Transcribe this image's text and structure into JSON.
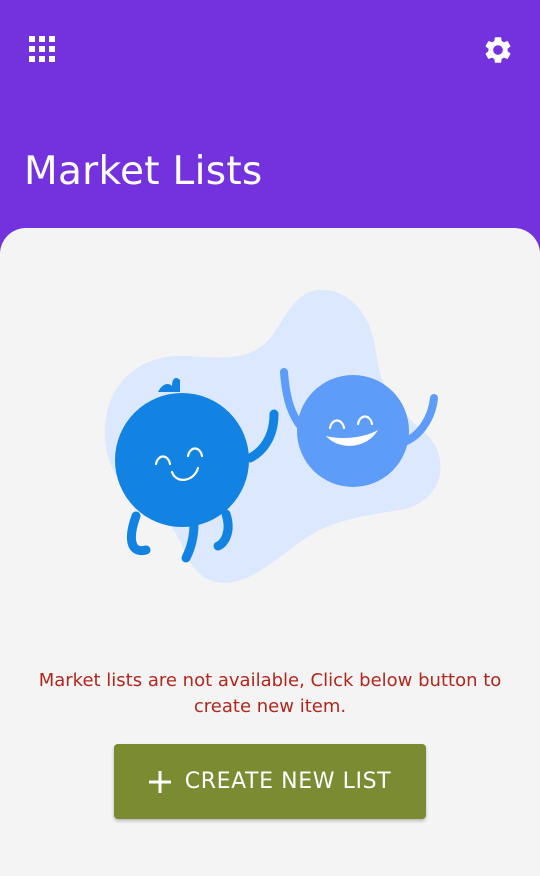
{
  "header": {
    "title": "Market Lists",
    "apps_icon": "grid-apps-icon",
    "settings_icon": "gear-icon"
  },
  "empty_state": {
    "illustration": "happy-blue-characters-illustration",
    "message": "Market lists are not available, Click below button to create new item."
  },
  "create_button": {
    "icon": "plus-icon",
    "label": "CREATE NEW LIST"
  },
  "colors": {
    "header_bg": "#7432de",
    "content_bg": "#f4f4f4",
    "message_text": "#b3261e",
    "button_bg": "#7a8b32",
    "character_dark": "#1283e2",
    "character_light": "#5e9cf9",
    "blob": "#dce8fd"
  }
}
